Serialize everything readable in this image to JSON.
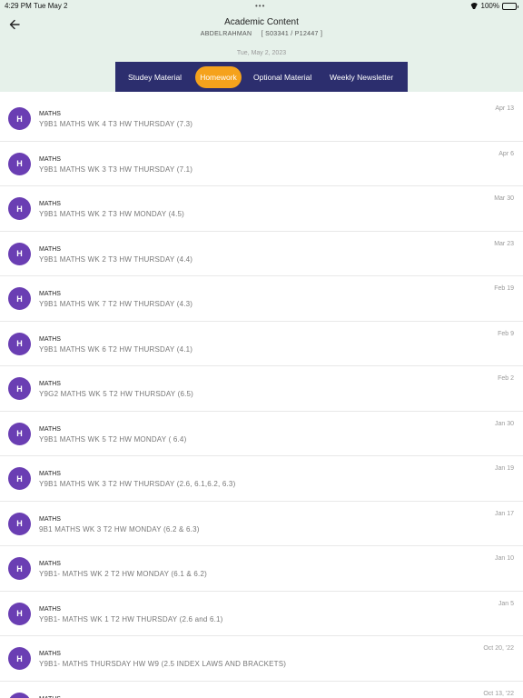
{
  "status": {
    "time": "4:29 PM",
    "date": "Tue May 2",
    "dots": "•••",
    "battery": "100%",
    "battery_level": 1.0
  },
  "header": {
    "title": "Academic Content",
    "student_name": "ABDELRAHMAN",
    "student_ids": "[ S03341 / P12447 ]",
    "date": "Tue, May 2, 2023"
  },
  "tabs": [
    {
      "label": "Studey Material",
      "active": false
    },
    {
      "label": "Homework",
      "active": true
    },
    {
      "label": "Optional Material",
      "active": false
    },
    {
      "label": "Weekly Newsletter",
      "active": false
    }
  ],
  "colors": {
    "header_bg": "#e6f1ea",
    "tabbar_bg": "#2c2e6e",
    "active_tab": "#f5a21c",
    "avatar": "#6a3eb3"
  },
  "items": [
    {
      "avatar": "H",
      "subject": "MATHS",
      "title": "Y9B1 MATHS WK 4 T3 HW THURSDAY (7.3)",
      "date": "Apr 13"
    },
    {
      "avatar": "H",
      "subject": "MATHS",
      "title": "Y9B1 MATHS WK 3 T3 HW THURSDAY (7.1)",
      "date": "Apr 6"
    },
    {
      "avatar": "H",
      "subject": "MATHS",
      "title": "Y9B1 MATHS WK 2 T3 HW MONDAY (4.5)",
      "date": "Mar 30"
    },
    {
      "avatar": "H",
      "subject": "MATHS",
      "title": "Y9B1 MATHS WK 2 T3 HW THURSDAY (4.4)",
      "date": "Mar 23"
    },
    {
      "avatar": "H",
      "subject": "MATHS",
      "title": "Y9B1 MATHS WK 7 T2 HW THURSDAY (4.3)",
      "date": "Feb 19"
    },
    {
      "avatar": "H",
      "subject": "MATHS",
      "title": "Y9B1 MATHS WK 6 T2 HW THURSDAY (4.1)",
      "date": "Feb 9"
    },
    {
      "avatar": "H",
      "subject": "MATHS",
      "title": "Y9G2 MATHS WK 5 T2 HW THURSDAY (6.5)",
      "date": "Feb 2"
    },
    {
      "avatar": "H",
      "subject": "MATHS",
      "title": "Y9B1 MATHS WK 5 T2 HW MONDAY ( 6.4)",
      "date": "Jan 30"
    },
    {
      "avatar": "H",
      "subject": "MATHS",
      "title": "Y9B1 MATHS WK 3 T2 HW THURSDAY (2.6, 6.1,6.2, 6.3)",
      "date": "Jan 19"
    },
    {
      "avatar": "H",
      "subject": "MATHS",
      "title": "9B1 MATHS WK 3 T2 HW MONDAY (6.2 & 6.3)",
      "date": "Jan 17"
    },
    {
      "avatar": "H",
      "subject": "MATHS",
      "title": "Y9B1- MATHS WK 2 T2 HW MONDAY (6.1 & 6.2)",
      "date": "Jan 10"
    },
    {
      "avatar": "H",
      "subject": "MATHS",
      "title": "Y9B1- MATHS WK 1 T2 HW THURSDAY (2.6 and 6.1)",
      "date": "Jan 5"
    },
    {
      "avatar": "H",
      "subject": "MATHS",
      "title": "Y9B1- MATHS THURSDAY HW W9 (2.5 INDEX LAWS AND BRACKETS)",
      "date": "Oct 20, '22"
    },
    {
      "avatar": "H",
      "subject": "MATHS",
      "title": "",
      "date": "Oct 13, '22"
    }
  ]
}
